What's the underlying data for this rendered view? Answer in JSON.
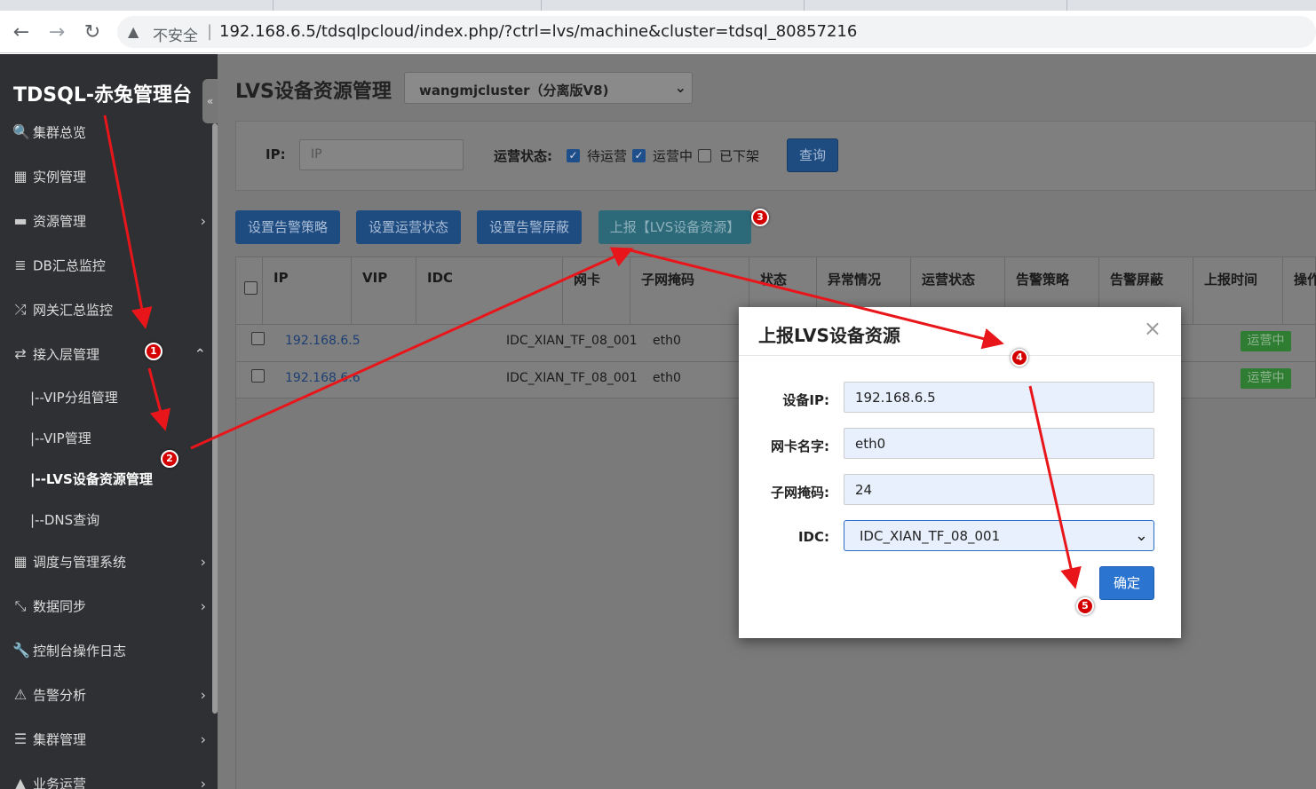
{
  "browser": {
    "back_icon": "arrow-left-icon",
    "forward_icon": "arrow-right-icon",
    "reload_icon": "reload-icon",
    "security_icon": "warning-triangle-icon",
    "insecure_label": "不安全",
    "separator": "|",
    "url": "192.168.6.5/tdsqlpcloud/index.php/?ctrl=lvs/machine&cluster=tdsql_80857216"
  },
  "sidebar": {
    "brand": "TDSQL-赤兔管理台",
    "collapse_glyph": "«",
    "items": [
      {
        "label": "集群总览",
        "icon": "search-icon",
        "glyph": "🔍"
      },
      {
        "label": "实例管理",
        "icon": "grid-icon",
        "glyph": "▦"
      },
      {
        "label": "资源管理",
        "icon": "hdd-icon",
        "glyph": "▬",
        "chevron": "›"
      },
      {
        "label": "DB汇总监控",
        "icon": "database-icon",
        "glyph": "≣"
      },
      {
        "label": "网关汇总监控",
        "icon": "shuffle-icon",
        "glyph": "⤮"
      },
      {
        "label": "接入层管理",
        "icon": "retweet-icon",
        "glyph": "⇄",
        "chevron": "⌃"
      },
      {
        "label": "调度与管理系统",
        "icon": "th-large-icon",
        "glyph": "▦",
        "chevron": "›"
      },
      {
        "label": "数据同步",
        "icon": "compress-icon",
        "glyph": "⤡",
        "chevron": "›"
      },
      {
        "label": "控制台操作日志",
        "icon": "wrench-icon",
        "glyph": "🔧"
      },
      {
        "label": "告警分析",
        "icon": "alert-icon",
        "glyph": "⚠",
        "chevron": "›"
      },
      {
        "label": "集群管理",
        "icon": "list-icon",
        "glyph": "☰",
        "chevron": "›"
      },
      {
        "label": "业务运营",
        "icon": "road-icon",
        "glyph": "▲",
        "chevron": "›"
      }
    ],
    "sub_items": [
      {
        "label": "|--VIP分组管理"
      },
      {
        "label": "|--VIP管理"
      },
      {
        "label": "|--LVS设备资源管理"
      },
      {
        "label": "|--DNS查询"
      }
    ]
  },
  "main": {
    "title": "LVS设备资源管理",
    "cluster_select": "wangmjcluster（分离版V8)",
    "filter": {
      "ip_label": "IP:",
      "ip_placeholder": "IP",
      "status_label": "运营状态:",
      "options": [
        {
          "label": "待运营",
          "checked": true
        },
        {
          "label": "运营中",
          "checked": true
        },
        {
          "label": "已下架",
          "checked": false
        }
      ],
      "query_button": "查询"
    },
    "actions": [
      "设置告警策略",
      "设置运营状态",
      "设置告警屏蔽",
      "上报【LVS设备资源】"
    ],
    "table": {
      "headers": [
        "IP",
        "VIP",
        "IDC",
        "网卡",
        "子网掩码",
        "状态",
        "异常情况",
        "运营状态",
        "告警策略",
        "告警屏蔽",
        "上报时间",
        "操作"
      ],
      "rows": [
        {
          "ip": "192.168.6.5",
          "idc": "IDC_XIAN_TF_08_001",
          "nic": "eth0",
          "status_badge": "运营中"
        },
        {
          "ip": "192.168.6.6",
          "idc": "IDC_XIAN_TF_08_001",
          "nic": "eth0",
          "status_badge": "运营中"
        }
      ]
    }
  },
  "modal": {
    "title": "上报LVS设备资源",
    "close_glyph": "×",
    "fields": {
      "device_ip": {
        "label": "设备IP:",
        "value": "192.168.6.5"
      },
      "nic_name": {
        "label": "网卡名字:",
        "value": "eth0"
      },
      "subnet_mask": {
        "label": "子网掩码:",
        "value": "24"
      },
      "idc": {
        "label": "IDC:",
        "value": "IDC_XIAN_TF_08_001"
      }
    },
    "confirm_button": "确定"
  },
  "annotations": {
    "markers": [
      "1",
      "2",
      "3",
      "4",
      "5"
    ],
    "arrow_color": "#e8161a"
  }
}
